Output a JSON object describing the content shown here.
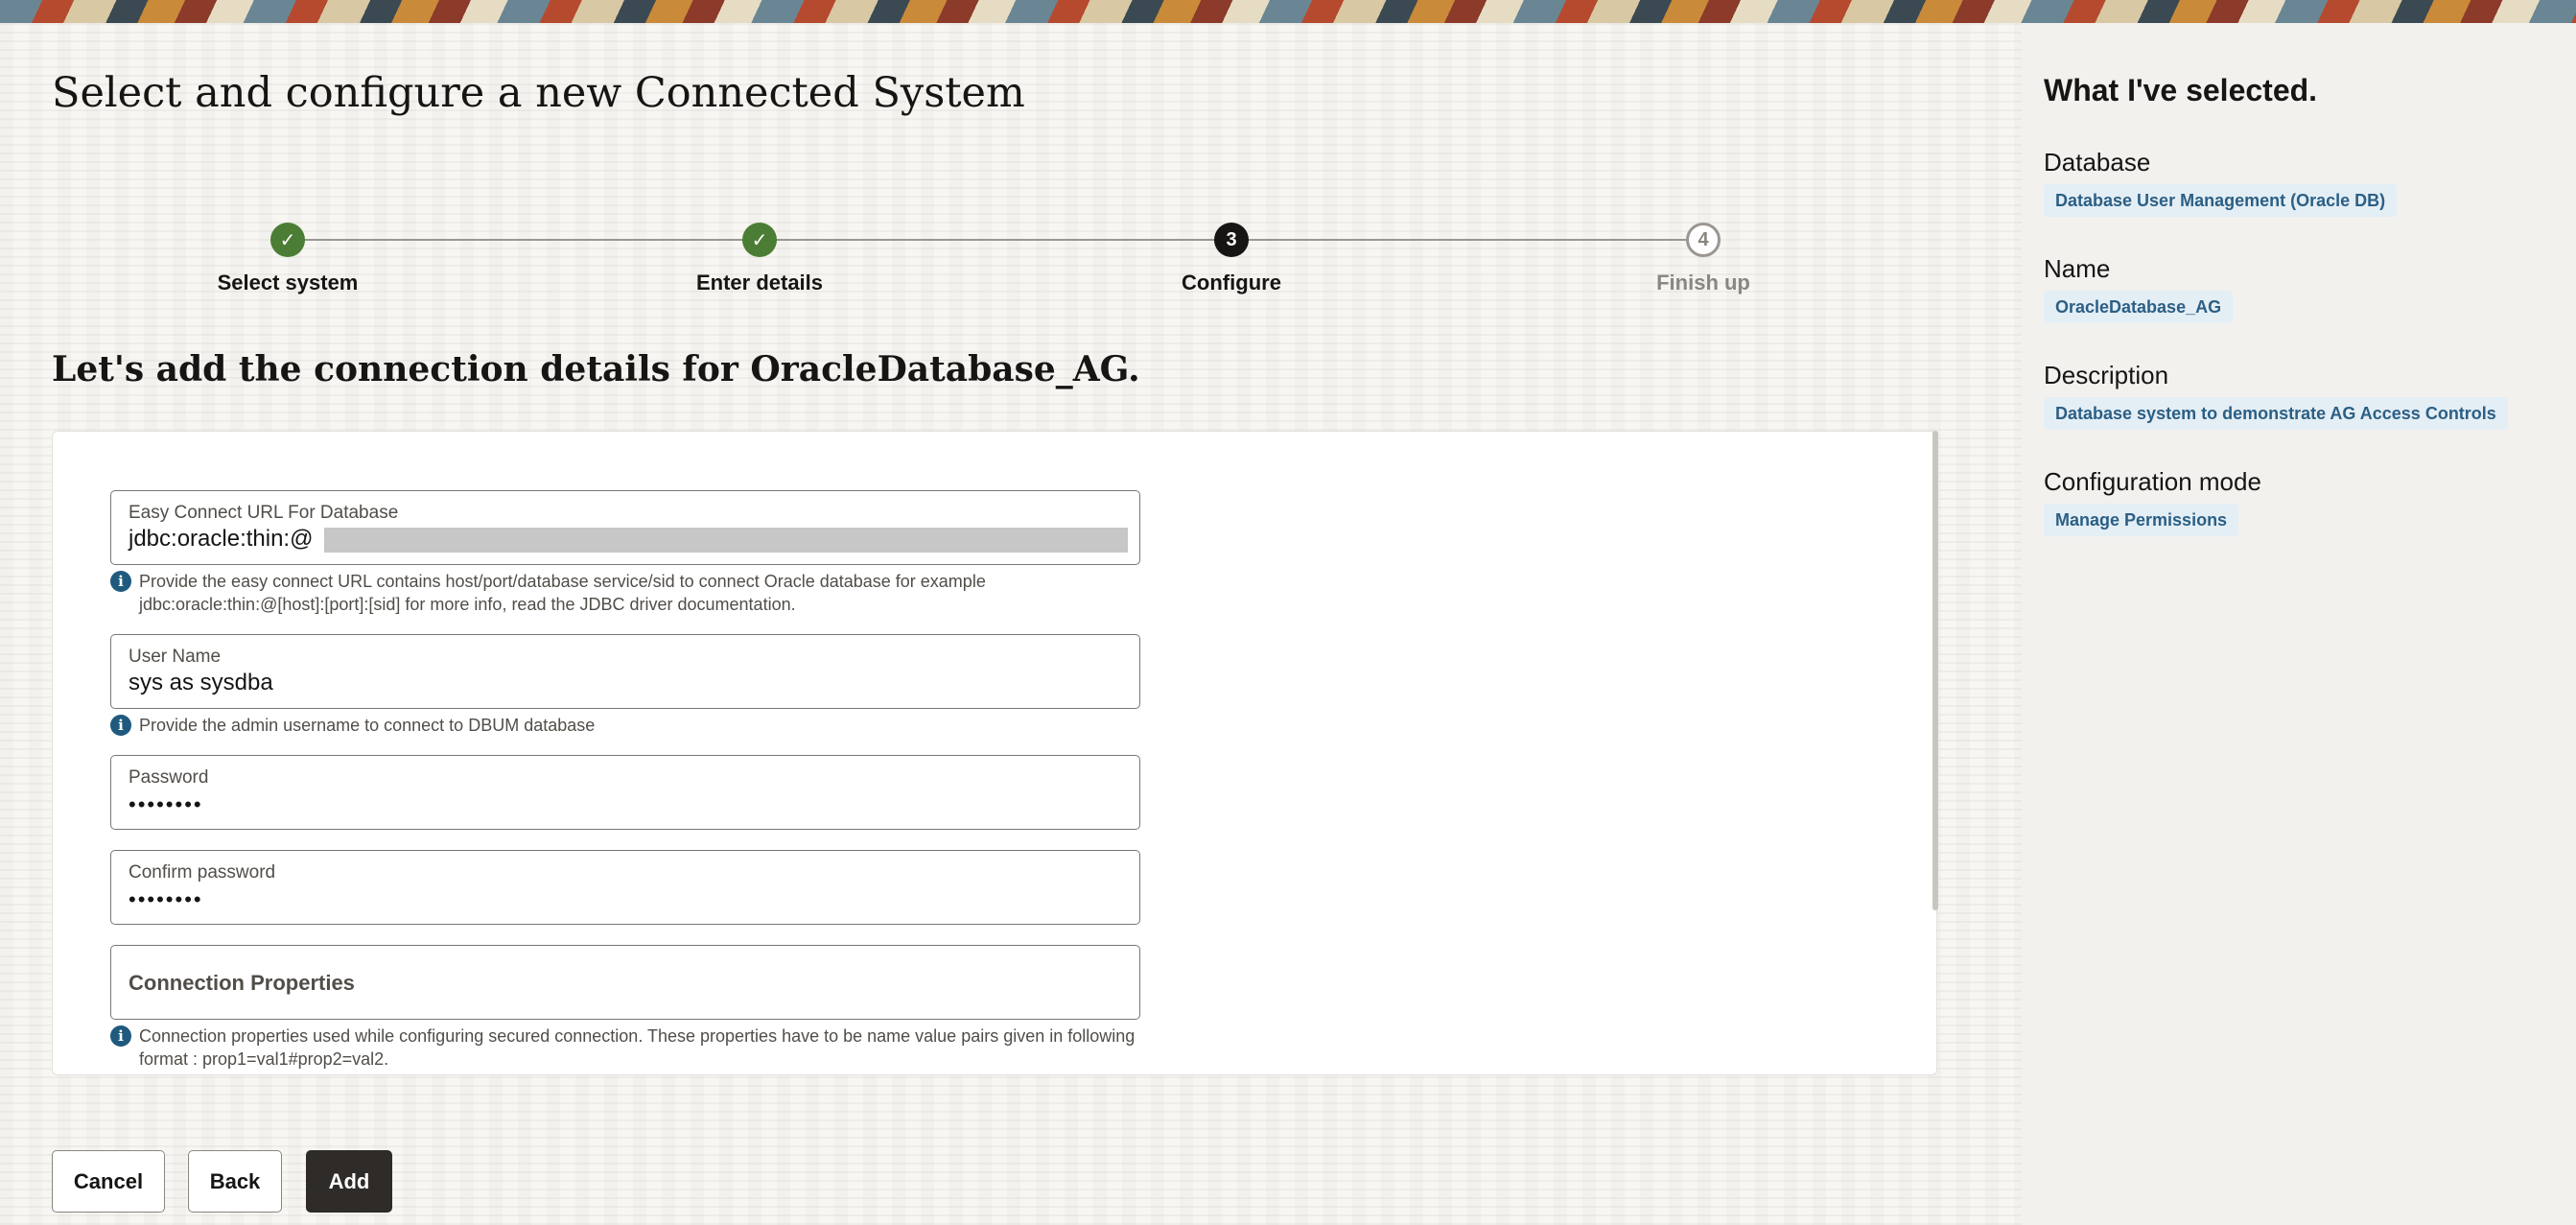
{
  "page": {
    "title": "Select and configure a new Connected System",
    "subtitle": "Let's add the connection details for OracleDatabase_AG."
  },
  "stepper": {
    "steps": [
      {
        "label": "Select system",
        "state": "done",
        "marker": "✓"
      },
      {
        "label": "Enter details",
        "state": "done",
        "marker": "✓"
      },
      {
        "label": "Configure",
        "state": "current",
        "marker": "3"
      },
      {
        "label": "Finish up",
        "state": "future",
        "marker": "4"
      }
    ]
  },
  "form": {
    "easy_connect": {
      "label": "Easy Connect URL For Database",
      "value": "jdbc:oracle:thin:@",
      "help": "Provide the easy connect URL contains host/port/database service/sid to connect Oracle database for example jdbc:oracle:thin:@[host]:[port]:[sid] for more info, read the JDBC driver documentation."
    },
    "user_name": {
      "label": "User Name",
      "value": "sys as sysdba",
      "help": "Provide the admin username to connect to DBUM database"
    },
    "password": {
      "label": "Password",
      "value": "••••••••"
    },
    "confirm_password": {
      "label": "Confirm password",
      "value": "••••••••"
    },
    "connection_properties": {
      "label": "Connection Properties",
      "help": "Connection properties used while configuring secured connection. These properties have to be name value pairs given in following format : prop1=val1#prop2=val2."
    }
  },
  "buttons": {
    "cancel": "Cancel",
    "back": "Back",
    "add": "Add"
  },
  "summary": {
    "title": "What I've selected.",
    "items": [
      {
        "label": "Database",
        "value": "Database User Management (Oracle DB)"
      },
      {
        "label": "Name",
        "value": "OracleDatabase_AG"
      },
      {
        "label": "Description",
        "value": "Database system to demonstrate AG Access Controls"
      },
      {
        "label": "Configuration mode",
        "value": "Manage Permissions"
      }
    ]
  },
  "icons": {
    "info": "info-icon",
    "check": "checkmark-icon"
  },
  "colors": {
    "step_done": "#4c7d35",
    "step_current": "#161513",
    "info_icon": "#1f5a7e",
    "chip_bg": "#e4eef5",
    "chip_text": "#2b5f85",
    "primary_button": "#2e2b28"
  }
}
